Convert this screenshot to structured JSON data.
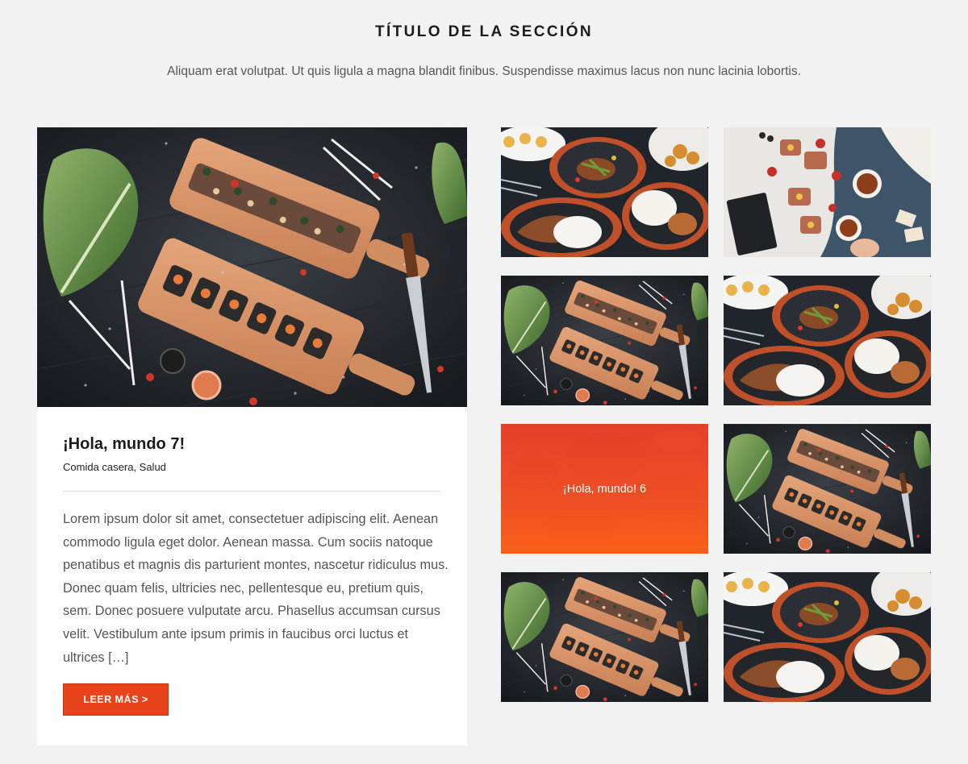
{
  "section": {
    "title": "TÍTULO DE LA SECCIÓN",
    "subtitle": "Aliquam erat volutpat. Ut quis ligula a magna blandit finibus. Suspendisse maximus lacus non nunc lacinia lobortis."
  },
  "featured_post": {
    "title": "¡Hola, mundo 7!",
    "categories": "Comida casera, Salud",
    "excerpt": "Lorem ipsum dolor sit amet, consectetuer adipiscing elit. Aenean commodo ligula eget dolor. Aenean massa. Cum sociis natoque penatibus et magnis dis parturient montes, nascetur ridiculus mus. Donec quam felis, ultricies nec, pellentesque eu, pretium quis, sem. Donec posuere vulputate arcu. Phasellus accumsan cursus velit. Vestibulum ante ipsum primis in faucibus orci luctus et ultrices […]",
    "read_more_label": "LEER MÁS >",
    "image": "sushi-boards"
  },
  "grid_posts": [
    {
      "image": "dinner-plates"
    },
    {
      "image": "breakfast-tea"
    },
    {
      "image": "sushi-boards"
    },
    {
      "image": "dinner-plates"
    },
    {
      "image": "red-overlay",
      "hover_title": "¡Hola, mundo! 6"
    },
    {
      "image": "sushi-boards"
    },
    {
      "image": "sushi-boards"
    },
    {
      "image": "dinner-plates"
    }
  ],
  "colors": {
    "accent": "#e8431a",
    "page_background": "#f2f2f2",
    "card_background": "#ffffff"
  }
}
